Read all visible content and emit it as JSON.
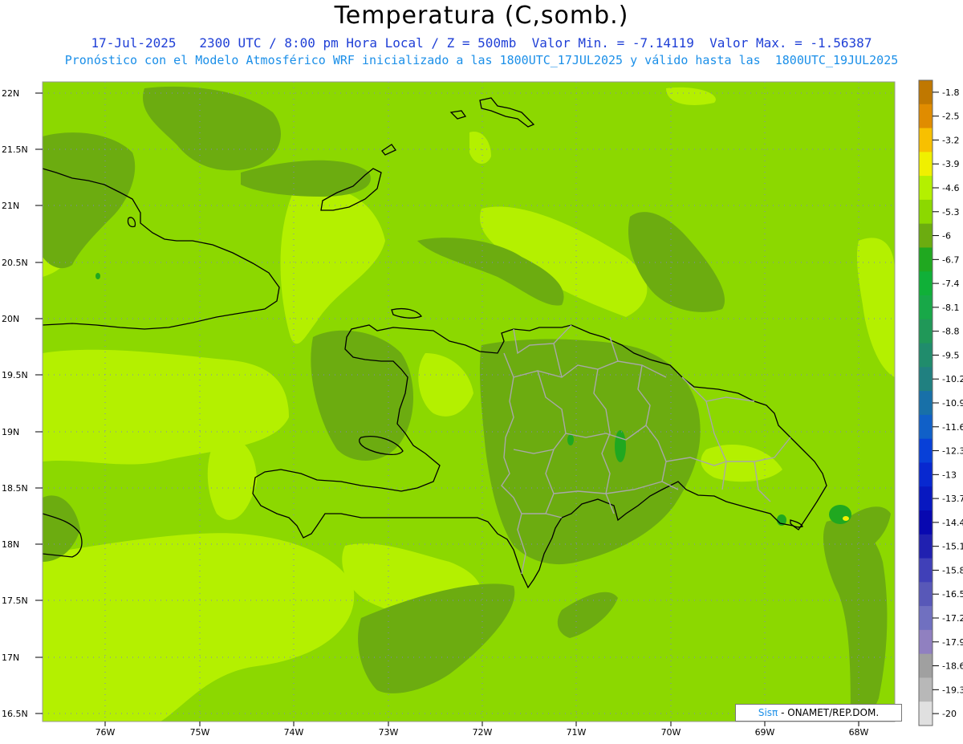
{
  "header": {
    "title": "Temperatura (C,somb.)",
    "line1": "17-Jul-2025   2300 UTC / 8:00 pm Hora Local / Z = 500mb  Valor Min. = -7.14119  Valor Max. = -1.56387",
    "line2": "Pronóstico con el Modelo Atmosférico WRF inicializado a las 1800UTC_17JUL2025 y válido hasta las  1800UTC_19JUL2025"
  },
  "axes": {
    "lat_labels": [
      "22N",
      "21.5N",
      "21N",
      "20.5N",
      "20N",
      "19.5N",
      "19N",
      "18.5N",
      "18N",
      "17.5N",
      "17N",
      "16.5N"
    ],
    "lon_labels": [
      "76W",
      "75W",
      "74W",
      "73W",
      "72W",
      "71W",
      "70W",
      "69W",
      "68W"
    ]
  },
  "colorbar": {
    "labels": [
      "-1.8",
      "-2.5",
      "-3.2",
      "-3.9",
      "-4.6",
      "-5.3",
      "-6",
      "-6.7",
      "-7.4",
      "-8.1",
      "-8.8",
      "-9.5",
      "-10.2",
      "-10.9",
      "-11.6",
      "-12.3",
      "-13",
      "-13.7",
      "-14.4",
      "-15.1",
      "-15.8",
      "-16.5",
      "-17.2",
      "-17.9",
      "-18.6",
      "-19.3",
      "-20"
    ],
    "colors": [
      "#c07800",
      "#e08c00",
      "#f8c000",
      "#f0f000",
      "#b4f000",
      "#8cd800",
      "#6cac10",
      "#20a820",
      "#10b038",
      "#18a848",
      "#209858",
      "#208c6c",
      "#208080",
      "#1870a8",
      "#1060c8",
      "#0840d8",
      "#0828d0",
      "#0818c0",
      "#0808b0",
      "#2020b0",
      "#4040b8",
      "#5858b8",
      "#7070c0",
      "#9080c0",
      "#a0a0a0",
      "#b8b8b8",
      "#e0e0e0"
    ]
  },
  "colors": {
    "field_base": "#8cd800",
    "field_light": "#b4f000",
    "field_dark": "#6cac10",
    "field_green": "#20a820",
    "field_yellow": "#f0f000",
    "coastline": "#000000",
    "provinces": "#a8a8a8",
    "grid": "#8080c8"
  },
  "credit": {
    "brand": "Sisπ",
    "text": " - ONAMET/REP.DOM."
  }
}
